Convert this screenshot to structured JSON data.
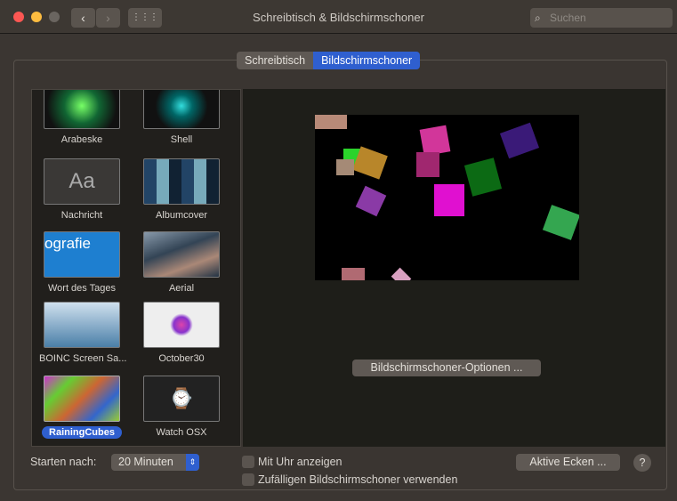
{
  "window": {
    "title": "Schreibtisch & Bildschirmschoner",
    "search_placeholder": "Suchen",
    "back": "‹",
    "forward": "›",
    "grid": "⋮⋮⋮"
  },
  "tabs": [
    {
      "label": "Schreibtisch",
      "active": false
    },
    {
      "label": "Bildschirmschoner",
      "active": true
    }
  ],
  "savers": [
    {
      "label": "Arabeske"
    },
    {
      "label": "Shell"
    },
    {
      "label": "Nachricht",
      "thumb_text": "Aa"
    },
    {
      "label": "Albumcover"
    },
    {
      "label": "Wort des Tages",
      "thumb_text": "ografie"
    },
    {
      "label": "Aerial"
    },
    {
      "label": "BOINC Screen Sa..."
    },
    {
      "label": "October30"
    },
    {
      "label": "RainingCubes",
      "selected": true
    },
    {
      "label": "Watch OSX"
    }
  ],
  "options_button": "Bildschirmschoner-Optionen ...",
  "start_after": {
    "label": "Starten nach:",
    "value": "20 Minuten"
  },
  "show_clock": {
    "label": "Mit Uhr anzeigen",
    "checked": false
  },
  "random": {
    "label": "Zufälligen Bildschirmschoner verwenden",
    "checked": false
  },
  "hot_corners": "Aktive Ecken ...",
  "help": "?",
  "colors": {
    "accent": "#2f5fcf"
  }
}
